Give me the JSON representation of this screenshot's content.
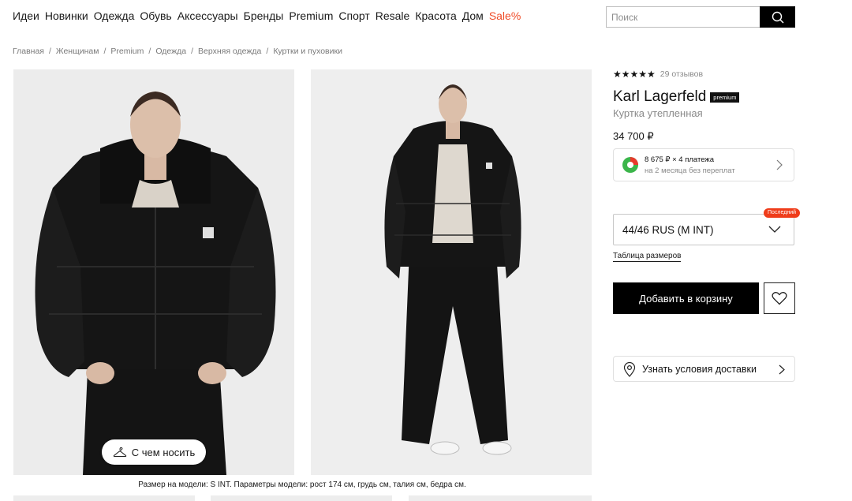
{
  "nav": {
    "items": [
      "Идеи",
      "Новинки",
      "Одежда",
      "Обувь",
      "Аксессуары",
      "Бренды",
      "Premium",
      "Спорт",
      "Resale",
      "Красота",
      "Дом"
    ],
    "sale": "Sale%"
  },
  "search": {
    "placeholder": "Поиск",
    "icon": "search-icon"
  },
  "breadcrumbs": [
    "Главная",
    "Женщинам",
    "Premium",
    "Одежда",
    "Верхняя одежда",
    "Куртки и пуховики"
  ],
  "gallery": {
    "wear_button": "С чем носить",
    "caption": "Размер на модели: S INT. Параметры модели: рост 174 см, грудь см, талия см, бедра см."
  },
  "product": {
    "stars": "★★★★★",
    "reviews": "29 отзывов",
    "brand": "Karl Lagerfeld",
    "badge": "premium",
    "subtitle": "Куртка утепленная",
    "price": "34 700 ₽",
    "split_line1": "8 675 ₽ × 4 платежа",
    "split_line2": "на 2 месяца без переплат",
    "size_value": "44/46 RUS (M INT)",
    "size_badge": "Последний",
    "size_table": "Таблица размеров",
    "add_to_cart": "Добавить в корзину",
    "delivery": "Узнать условия доставки"
  },
  "colors": {
    "accent": "#ef4b27",
    "badge_red": "#ef3d1b",
    "jacket": "#111111",
    "photo_bg": "#ececec"
  }
}
